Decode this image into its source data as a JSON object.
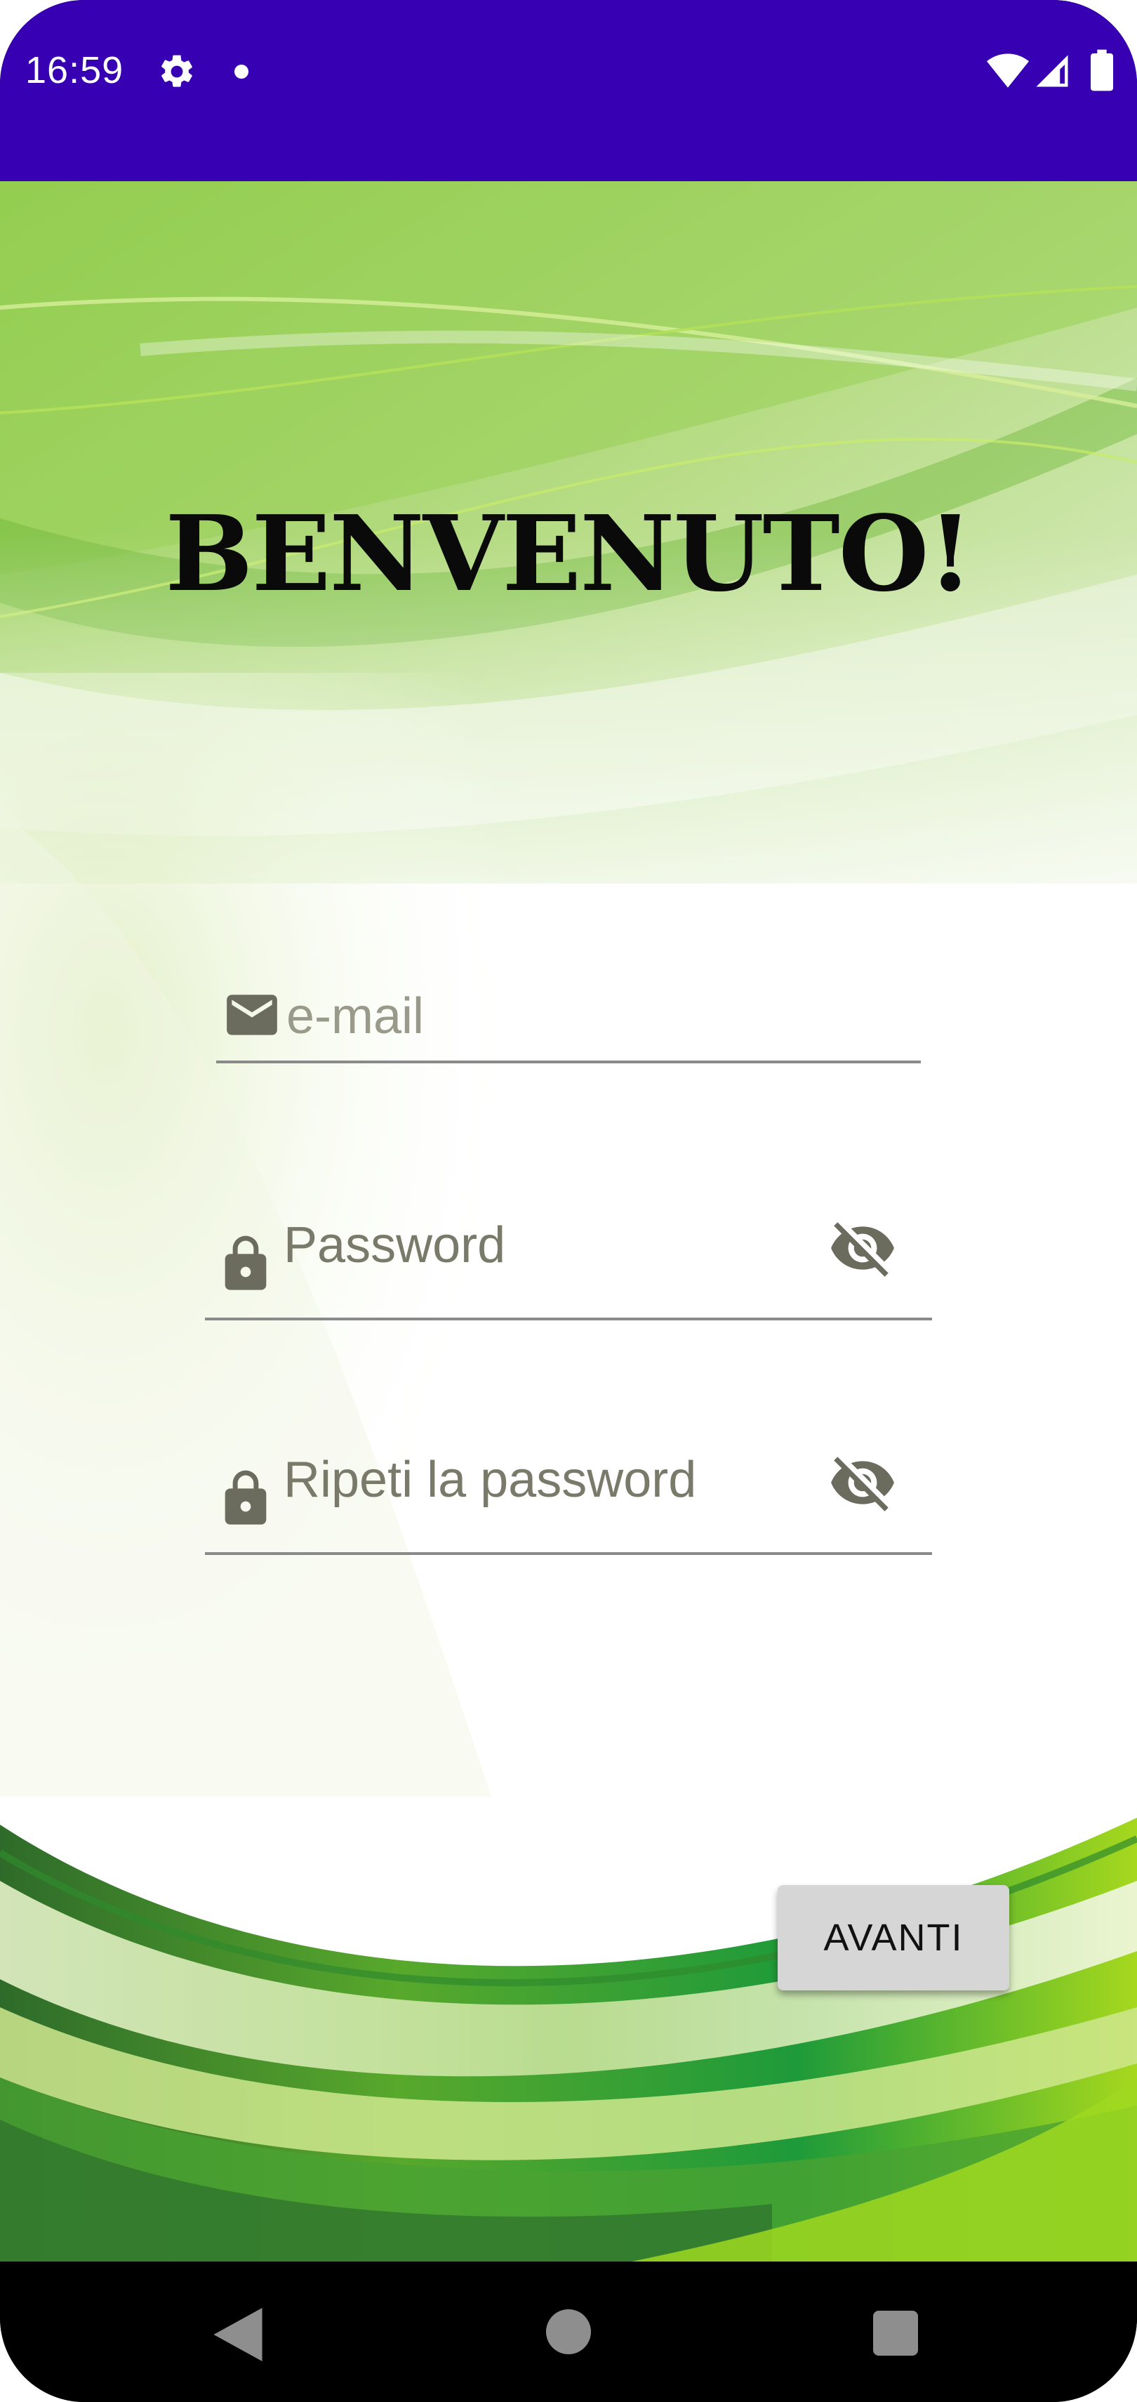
{
  "status_bar": {
    "time": "16:59",
    "icons": [
      "gear-icon",
      "notification-dot-icon",
      "wifi-icon",
      "signal-icon",
      "battery-icon"
    ],
    "background_color": "#3700b3"
  },
  "screen": {
    "title": "BENVENUTO!",
    "fields": {
      "email": {
        "placeholder": "e-mail",
        "icon": "mail-icon"
      },
      "password": {
        "placeholder": "Password",
        "icon": "lock-icon",
        "toggle_icon": "eye-off-icon"
      },
      "repeat_password": {
        "placeholder": "Ripeti la password",
        "icon": "lock-icon",
        "toggle_icon": "eye-off-icon"
      }
    },
    "next_button_label": "AVANTI"
  },
  "nav_bar": {
    "icons": [
      "back-triangle-icon",
      "home-circle-icon",
      "recents-square-icon"
    ]
  },
  "colors": {
    "accent_green": "#6cbf2a",
    "dark_green": "#1f7a2a",
    "icon_gray": "#6b6b5e"
  }
}
